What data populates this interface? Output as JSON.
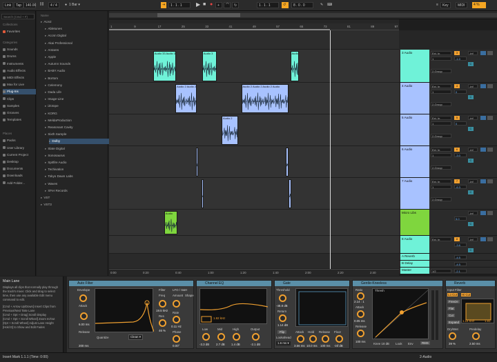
{
  "topbar": {
    "link": "Link",
    "tap": "Tap",
    "tempo": "140.00",
    "meter": "4 / 4",
    "bar": "1 Bar",
    "position": "1 . 1 . 1",
    "loop_start": "1 . 1 . 1",
    "loop_len": "8 . 0 . 0",
    "key": "Key",
    "midi": "MIDI",
    "cpu": "4 %"
  },
  "browser": {
    "search_placeholder": "Search (Cmd + F)",
    "collections_header": "Collections",
    "collections": [
      "Favorites"
    ],
    "categories_header": "Categories",
    "categories": [
      "Sounds",
      "Drums",
      "Instruments",
      "Audio Effects",
      "MIDI Effects",
      "Max for Live",
      "Plug-Ins",
      "Clips",
      "Samples",
      "Grooves",
      "Templates"
    ],
    "places_header": "Places",
    "places": [
      "Packs",
      "User Library",
      "Current Project",
      "Desktop",
      "Documents",
      "Downloads",
      "Add Folder..."
    ],
    "name_header": "Name",
    "plugins": [
      "AUv2",
      "Abletunes",
      "Accsn Digital",
      "Akai Professional",
      "Antares",
      "Apple",
      "Autumn Sounds",
      "BABY Audio",
      "Bortom",
      "Celemony",
      "Dada Life",
      "Image-Line",
      "iZotope",
      "KORG",
      "MeldaProduction",
      "Reasonant Cavity",
      "Sixth Sample",
      "Dolby",
      "Slate Digital",
      "Sonosaurus",
      "Spitfire Audio",
      "Techivation",
      "Tokyo Dawn Labs",
      "Waves",
      "XFer Records",
      "VST",
      "VST3"
    ]
  },
  "ruler": {
    "marks": [
      "1",
      "9",
      "17",
      "25",
      "33",
      "41",
      "49",
      "57",
      "65",
      "73",
      "81",
      "89",
      "97"
    ]
  },
  "timebar": {
    "marks": [
      "0:00",
      "0:20",
      "0:40",
      "1:00",
      "1:20",
      "1:40",
      "2:00",
      "2:20",
      "2:40"
    ]
  },
  "tracks": [
    {
      "name": "3 Audio",
      "color": "#6ff2d8",
      "in": "Ext. In",
      "ch": "1",
      "group": "2-Group",
      "num": "3",
      "vol": "-1.0",
      "pan": "C",
      "send": "-inf",
      "clips": [
        {
          "label": "Audio 33 Audio 3",
          "start": 0.152,
          "w": 0.078
        },
        {
          "label": "Audio 3",
          "start": 0.321,
          "w": 0.05
        },
        {
          "label": "Audio",
          "start": 0.625,
          "w": 0.03
        }
      ]
    },
    {
      "name": "4 Audio",
      "color": "#a8c2ff",
      "in": "Ext. In",
      "ch": "1",
      "group": "2-Group",
      "num": "4",
      "vol": "0",
      "pan": "C",
      "send": "-inf",
      "clips": [
        {
          "label": "Audio 2 Audio 2",
          "start": 0.229,
          "w": 0.073
        },
        {
          "label": "Audio 2 Audio 2 Audio 2 Audio",
          "start": 0.456,
          "w": 0.162
        }
      ]
    },
    {
      "name": "5 Audio",
      "color": "#a8c2ff",
      "in": "Ext. In",
      "ch": "1",
      "group": "2-Group",
      "num": "5",
      "vol": "0",
      "pan": "C",
      "send": "-inf",
      "clips": [
        {
          "label": "Audio 2",
          "start": 0.388,
          "w": 0.058
        }
      ]
    },
    {
      "name": "6 Audio",
      "color": "#a8c2ff",
      "in": "Ext. In",
      "ch": "1",
      "group": "2-Group",
      "num": "6",
      "vol": "-3.0",
      "pan": "C",
      "send": "-inf",
      "clips": [
        {
          "label": "",
          "start": 0.3,
          "w": 0.008
        },
        {
          "label": "",
          "start": 0.609,
          "w": 0.01
        }
      ]
    },
    {
      "name": "7 Audio",
      "color": "#a8c2ff",
      "in": "Ext. In",
      "ch": "1",
      "group": "2-Group",
      "num": "7",
      "vol": "-6.3",
      "pan": "C",
      "send": "-inf",
      "clips": [
        {
          "label": "",
          "start": 0.319,
          "w": 0.008
        },
        {
          "label": "",
          "start": 0.62,
          "w": 0.008
        }
      ]
    },
    {
      "name": "Micro Libs",
      "color": "#7fd63e",
      "in": "",
      "ch": "",
      "group": "",
      "num": "",
      "vol": "5.0",
      "pan": "C",
      "send": "-inf",
      "clips": [
        {
          "label": "Audio",
          "start": 0.19,
          "w": 0.045
        }
      ]
    },
    {
      "name": "8 Audio",
      "color": "#6ff2d8",
      "in": "Ext. In",
      "ch": "",
      "group": "",
      "num": "8",
      "vol": "-3.6",
      "pan": "C",
      "send": "-inf",
      "clips": []
    }
  ],
  "returns": [
    {
      "name": "A Reverb",
      "color": "#6ff2d8",
      "vol": "-4.5"
    },
    {
      "name": "B Delay",
      "color": "#6ff2d8",
      "vol": "-4.5"
    },
    {
      "name": "Master",
      "color": "#6ff2d8",
      "vol": "-2.1",
      "ratio": "1/2"
    }
  ],
  "info": {
    "title": "Main Lane",
    "body": "Displays all clips that normally play through the track's mixer. Click and drag to select time, then use any available Edit menu command to edit.",
    "body2": "[Cmd + Arrow Up/Down] Insert Clips from Previous/Next Take Lane\n[Cmd + Opt + Drag] Scroll Display\n[Cmd + Opt + Scroll Wheel] Zoom In/Out\n[Opt + Scroll Wheel] Adjust Lane Height\n[Hold D] to Show and Edit Fades"
  },
  "devices": {
    "auto_filter": {
      "title": "Auto Filter",
      "envelope": "Envelope",
      "attack": "Attack",
      "attack_val": "6.00 ms",
      "release": "Release",
      "release_val": "200 ms",
      "filter": "Filter",
      "freq": "Freq",
      "freq_val": "19.5 kHz",
      "res": "Res",
      "res_val": "46 %",
      "lfo": "LFO / S&H",
      "amount": "Amount",
      "shape": "Shape",
      "rate": "Rate",
      "rate_val": "0.11 Hz",
      "phase": "Phase",
      "phase_val": "0.00°",
      "quantize": "Quantize",
      "clean": "Clean"
    },
    "channel_eq": {
      "title": "Channel EQ",
      "low": "Low",
      "mid": "Mid",
      "high": "High",
      "output": "Output",
      "low_val": "-3.3 dB",
      "mid_val": "2.7 dB",
      "high_val": "1.4 dB",
      "out_val": "-2.1 dB",
      "freq_val": "1.92 kHz",
      "db_top": "12",
      "db_mid": "0",
      "db_low": "-12"
    },
    "gate": {
      "title": "Gate",
      "threshold": "Threshold",
      "thr_val": "-48.8 dB",
      "return": "Return",
      "ret_val": "1.14 dB",
      "flip": "Flip",
      "lookahead": "Lookahead",
      "look_val": "1.6 ms",
      "attack": "Attack",
      "att_val": "3.56 ms",
      "hold": "Hold",
      "hold_val": "10.0 ms",
      "release": "Release",
      "rel_val": "100 ms",
      "floor": "Floor",
      "floor_val": "-inf dB"
    },
    "glue": {
      "title": "Gentle-Kneeless",
      "ratio": "Ratio",
      "ratio_val": "2.14 : 1",
      "attack": "Attack",
      "att_val": "0.05 ms",
      "release": "Release",
      "rel_val": "100 ms",
      "threshold": "Thresh",
      "knee": "Knee",
      "knee_val": "18 dB",
      "look": "Look",
      "env": "Env",
      "rms": "RMS"
    },
    "reverb": {
      "title": "Reverb",
      "input": "Input Filter",
      "low": "Lo Cut",
      "high": "Hi Cut",
      "val1": "1.14 kHz",
      "val2": "1.81",
      "freeze": "Freeze",
      "flat": "Flat",
      "cut": "Cut",
      "expand": "Expand",
      "predelay": "Predelay",
      "pd_val": "2.50 ms",
      "drywet": "Dry/Wet",
      "dw_val": "39 %",
      "gain": "Gain"
    }
  },
  "status": {
    "left": "Insert Mark 1.1.1 (Time: 0:00)",
    "right": "2-Audio"
  }
}
